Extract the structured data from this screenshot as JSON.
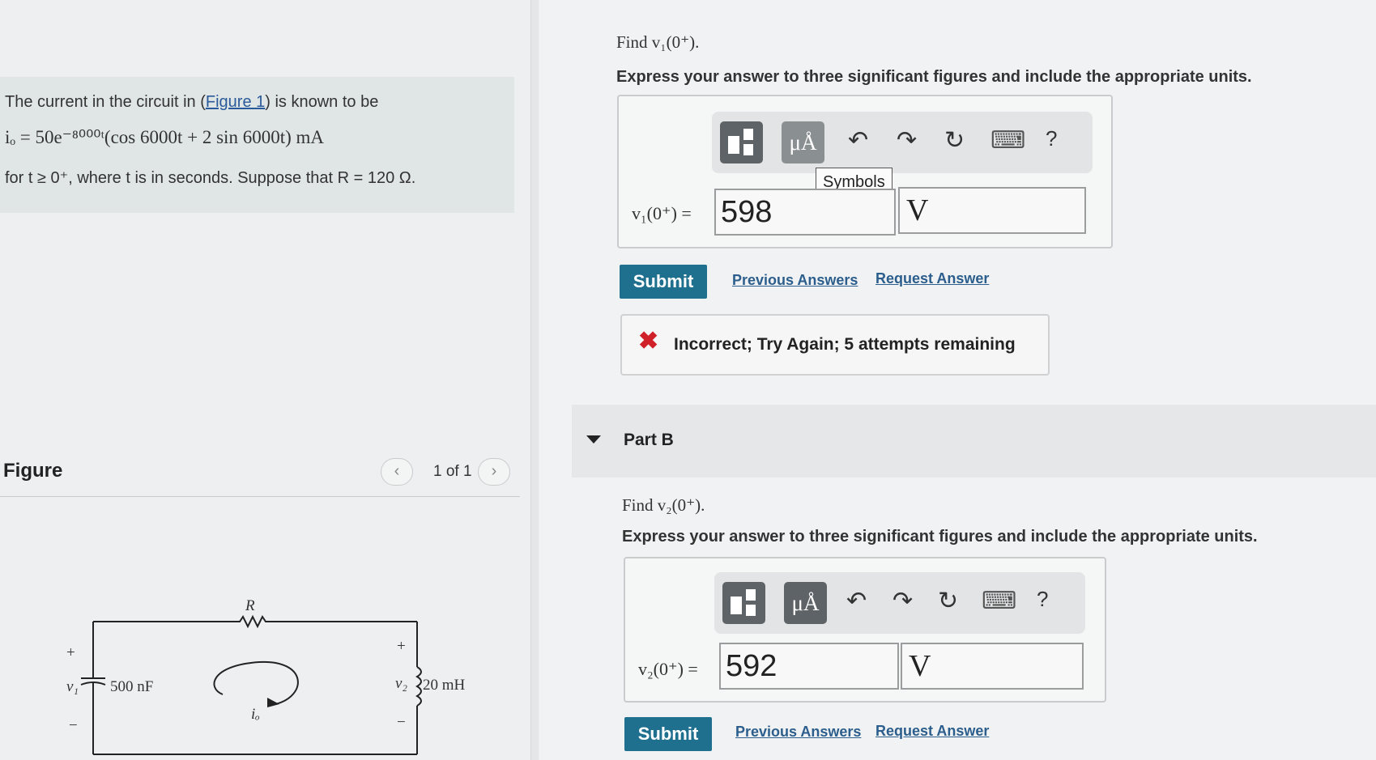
{
  "problem": {
    "intro_text": "The current in the circuit in (",
    "figure_link": "Figure 1",
    "intro_tail": ") is known to be",
    "equation": "iₒ = 50e⁻⁸⁰⁰⁰ᵗ(cos 6000t + 2 sin 6000t) mA",
    "condition": "for t ≥ 0⁺, where t is in seconds. Suppose that R = 120 Ω."
  },
  "figure": {
    "title": "Figure",
    "count": "1 of 1",
    "prev_glyph": "‹",
    "next_glyph": "›",
    "labels": {
      "r": "R",
      "plus_left": "+",
      "minus_left": "−",
      "v1": "v₁",
      "cap": "500 nF",
      "plus_right": "+",
      "minus_right": "−",
      "v2": "v₂",
      "ind": "20 mH",
      "io": "iₒ"
    }
  },
  "partA": {
    "find": "Find v₁(0⁺).",
    "instructions": "Express your answer to three significant figures and include the appropriate units.",
    "label": "v₁(0⁺) =",
    "value": "598",
    "unit": "V",
    "tooltip": "Symbols",
    "submit": "Submit",
    "previous_answers": "Previous Answers",
    "request_answer": "Request Answer",
    "feedback_icon": "✖",
    "feedback": "Incorrect; Try Again; 5 attempts remaining"
  },
  "partB": {
    "title": "Part B",
    "find": "Find v₂(0⁺).",
    "instructions": "Express your answer to three significant figures and include the appropriate units.",
    "label": "v₂(0⁺) =",
    "value": "592",
    "unit": "V",
    "submit": "Submit",
    "previous_answers": "Previous Answers",
    "request_answer": "Request Answer"
  },
  "toolbar": {
    "units_glyph": "μÅ",
    "undo_glyph": "↶",
    "redo_glyph": "↷",
    "reset_glyph": "↻",
    "keyboard_glyph": "⌨",
    "help_glyph": "?"
  }
}
